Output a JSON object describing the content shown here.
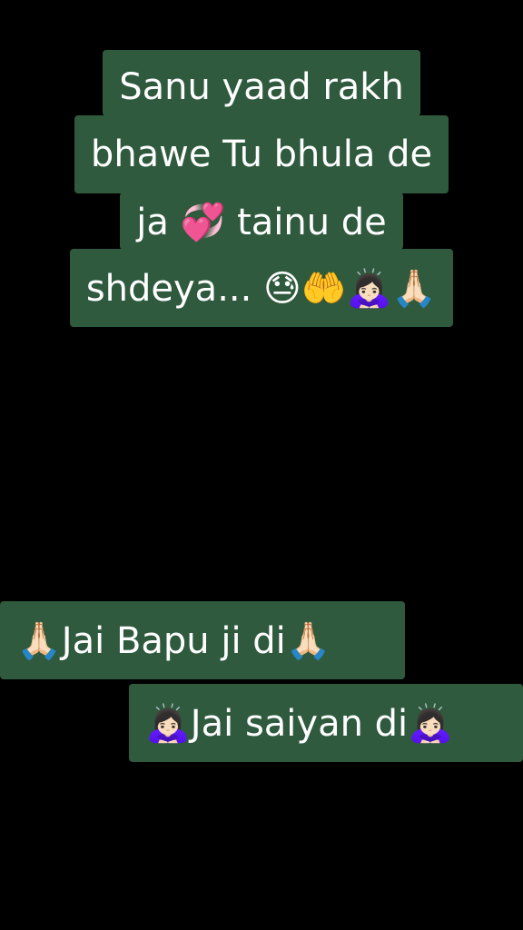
{
  "caption": {
    "lines": [
      "Sanu yaad rakh",
      "bhawe Tu bhula de",
      "ja 💞 tainu de",
      "shdeya... 😓🤲🙇🏻‍♀️🙏🏻"
    ]
  },
  "stickers": [
    {
      "text": "🙏🏻Jai Bapu ji di🙏🏻"
    },
    {
      "text": "🙇🏻‍♀️Jai saiyan di🙇🏻‍♀️"
    }
  ],
  "colors": {
    "background": "#000000",
    "text_box": "#2f5a3d",
    "text": "#ffffff"
  }
}
